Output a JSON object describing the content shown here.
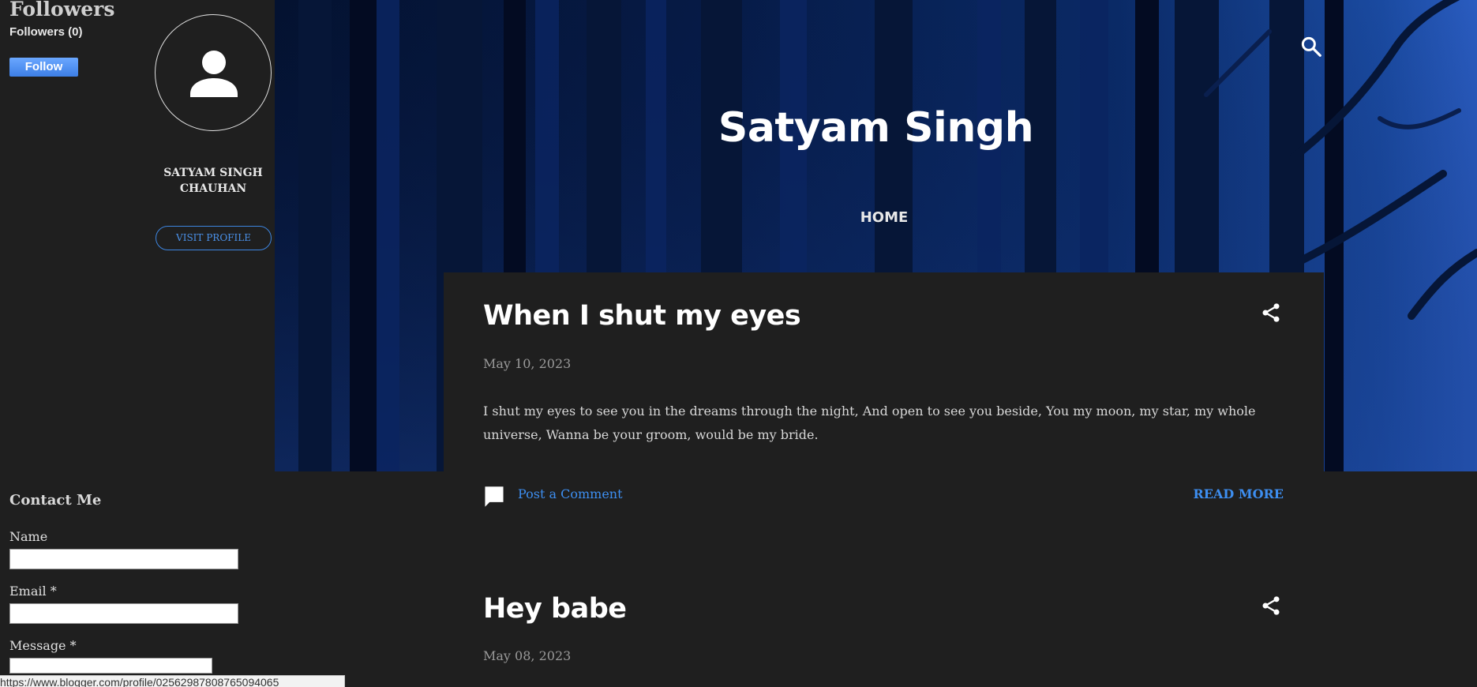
{
  "header": {
    "blog_title": "Satyam Singh",
    "nav_home": "HOME",
    "search_icon": "search-icon"
  },
  "sidebar": {
    "followers_heading": "Followers",
    "followers_count": "Followers (0)",
    "follow_button": "Follow",
    "profile_name": "SATYAM SINGH CHAUHAN",
    "visit_profile": "VISIT PROFILE",
    "contact": {
      "heading": "Contact Me",
      "name_label": "Name",
      "email_label": "Email *",
      "message_label": "Message *",
      "name_value": "",
      "email_value": "",
      "message_value": ""
    }
  },
  "posts": [
    {
      "title": "When I shut my eyes",
      "date": "May 10, 2023",
      "snippet": "I shut my eyes to see you in the dreams through the night, And open to see you beside, You my moon, my star, my whole universe, Wanna be your groom, would be my bride.",
      "comment_link": "Post a Comment",
      "read_more": "READ MORE"
    },
    {
      "title": "Hey babe",
      "date": "May 08, 2023"
    }
  ],
  "status_bar": {
    "url": "https://www.blogger.com/profile/02562987808765094065"
  },
  "colors": {
    "background": "#1f1f1f",
    "link": "#3d8ef0",
    "hero_dark": "#041230",
    "hero_light": "#2a5cc0",
    "follow_button": "#4a8cf0"
  }
}
